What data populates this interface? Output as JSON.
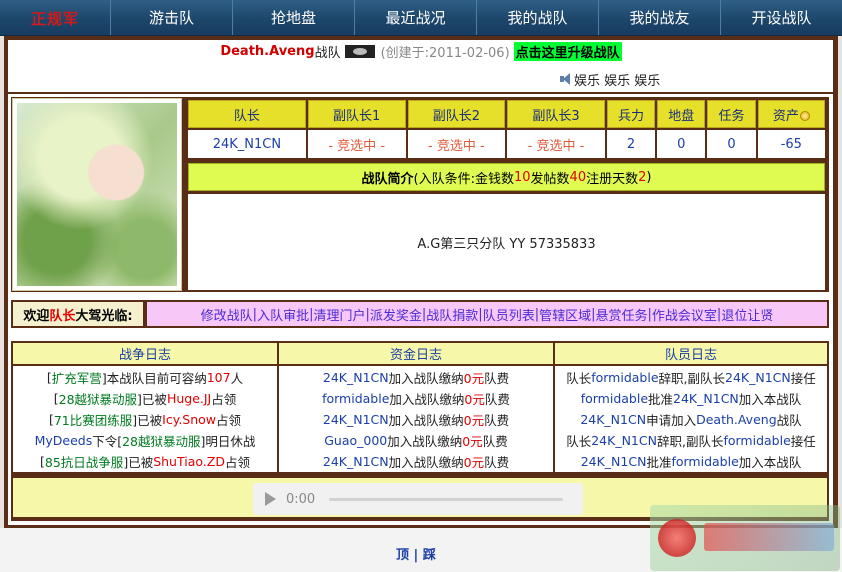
{
  "nav": {
    "logo": "正规军",
    "items": [
      "游击队",
      "抢地盘",
      "最近战况",
      "我的战队",
      "我的战友",
      "开设战队"
    ]
  },
  "header": {
    "team_name": "Death.Aveng",
    "team_suffix": "战队",
    "created": "(创建于:2011-02-06)",
    "upgrade": "点击这里升级战队"
  },
  "music": {
    "label": "娱乐 娱乐 娱乐"
  },
  "stats": {
    "headers": [
      "队长",
      "副队长1",
      "副队长2",
      "副队长3",
      "兵力",
      "地盘",
      "任务",
      "资产"
    ],
    "values": [
      "24K_N1CN",
      "- 竞选中 -",
      "- 竞选中 -",
      "- 竞选中 -",
      "2",
      "0",
      "0",
      "-65"
    ]
  },
  "intro": {
    "title": "战队简介",
    "cond_prefix": "(入队条件:金钱数",
    "money": "10",
    "posts_label": " 发帖数",
    "posts": "40",
    "days_label": " 注册天数",
    "days": "2",
    "cond_suffix": ")",
    "body": "A.G第三只分队 YY 57335833"
  },
  "manage": {
    "welcome_prefix": "欢迎",
    "role": "队长",
    "welcome_suffix": "大驾光临:",
    "links": [
      "修改战队",
      "入队审批",
      "清理门户",
      "派发奖金",
      "战队捐款",
      "队员列表",
      "管辖区域",
      "悬赏任务",
      "作战会议室",
      "退位让贤"
    ]
  },
  "logs": {
    "war": {
      "title": "战争日志",
      "rows": [
        [
          [
            "[",
            "dark"
          ],
          [
            "扩充军营",
            "green"
          ],
          [
            "]本战队目前可容纳",
            "dark"
          ],
          [
            "107",
            "red"
          ],
          [
            "人",
            "dark"
          ]
        ],
        [
          [
            "[",
            "dark"
          ],
          [
            "28越狱暴动服",
            "green"
          ],
          [
            "]已被",
            "dark"
          ],
          [
            "Huge.JJ",
            "red"
          ],
          [
            "占领",
            "dark"
          ]
        ],
        [
          [
            "[",
            "dark"
          ],
          [
            "71比赛团练服",
            "green"
          ],
          [
            "]已被",
            "dark"
          ],
          [
            "Icy.Snow",
            "red"
          ],
          [
            "占领",
            "dark"
          ]
        ],
        [
          [
            "MyDeeds",
            "blue"
          ],
          [
            "下令[",
            "dark"
          ],
          [
            "28越狱暴动服",
            "green"
          ],
          [
            "]明日休战",
            "dark"
          ]
        ],
        [
          [
            "[",
            "dark"
          ],
          [
            "85抗日战争服",
            "green"
          ],
          [
            "]已被",
            "dark"
          ],
          [
            "ShuTiao.ZD",
            "red"
          ],
          [
            "占领",
            "dark"
          ]
        ]
      ]
    },
    "fund": {
      "title": "资金日志",
      "rows": [
        [
          [
            "24K_N1CN",
            "blue"
          ],
          [
            "加入战队缴纳",
            "dark"
          ],
          [
            "0元",
            "red"
          ],
          [
            "队费",
            "dark"
          ]
        ],
        [
          [
            "formidable",
            "blue"
          ],
          [
            "加入战队缴纳",
            "dark"
          ],
          [
            "0元",
            "red"
          ],
          [
            "队费",
            "dark"
          ]
        ],
        [
          [
            "24K_N1CN",
            "blue"
          ],
          [
            "加入战队缴纳",
            "dark"
          ],
          [
            "0元",
            "red"
          ],
          [
            "队费",
            "dark"
          ]
        ],
        [
          [
            "Guao_000",
            "blue"
          ],
          [
            "加入战队缴纳",
            "dark"
          ],
          [
            "0元",
            "red"
          ],
          [
            "队费",
            "dark"
          ]
        ],
        [
          [
            "24K_N1CN",
            "blue"
          ],
          [
            "加入战队缴纳",
            "dark"
          ],
          [
            "0元",
            "red"
          ],
          [
            "队费",
            "dark"
          ]
        ]
      ]
    },
    "member": {
      "title": "队员日志",
      "rows": [
        [
          [
            "队长",
            "dark"
          ],
          [
            "formidable",
            "blue"
          ],
          [
            "辞职,副队长",
            "dark"
          ],
          [
            "24K_N1CN",
            "blue"
          ],
          [
            "接任",
            "dark"
          ]
        ],
        [
          [
            "formidable",
            "blue"
          ],
          [
            "批准",
            "dark"
          ],
          [
            "24K_N1CN",
            "blue"
          ],
          [
            "加入本战队",
            "dark"
          ]
        ],
        [
          [
            "24K_N1CN",
            "blue"
          ],
          [
            "申请加入",
            "dark"
          ],
          [
            "Death.Aveng",
            "blue"
          ],
          [
            "战队",
            "dark"
          ]
        ],
        [
          [
            "队长",
            "dark"
          ],
          [
            "24K_N1CN",
            "blue"
          ],
          [
            "辞职,副队长",
            "dark"
          ],
          [
            "formidable",
            "blue"
          ],
          [
            "接任",
            "dark"
          ]
        ],
        [
          [
            "24K_N1CN",
            "blue"
          ],
          [
            "批准",
            "dark"
          ],
          [
            "formidable",
            "blue"
          ],
          [
            "加入本战队",
            "dark"
          ]
        ]
      ]
    }
  },
  "player": {
    "time": "0:00",
    "progress": 0
  },
  "footer": {
    "top": "顶",
    "sep": "|",
    "step": "踩"
  },
  "colors": {
    "nav_bg": "#1d466b",
    "frame": "#5a2d17",
    "header_yellow": "#e6e02a",
    "intro_green": "#dffb52",
    "manage_pink": "#f7c8f7",
    "log_head": "#f7f7a9",
    "link_blue": "#1a3fa8",
    "accent_red": "#e30000"
  },
  "icons": {
    "flag": "pirate-flag-icon",
    "speaker": "speaker-icon",
    "coin": "coin-icon",
    "play": "play-icon"
  }
}
